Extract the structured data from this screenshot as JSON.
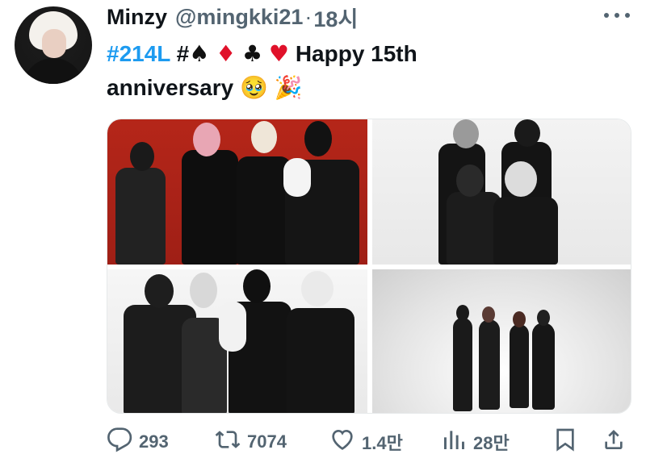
{
  "tweet": {
    "display_name": "Minzy",
    "handle": "@mingkki21",
    "separator": "·",
    "time": "18시",
    "text": {
      "hashtag": "#214L",
      "hash": "#",
      "suits": [
        "♠",
        "♦",
        "♣",
        "♥"
      ],
      "line1_rest": "Happy 15th",
      "line2": "anniversary",
      "emojis": [
        "🥹",
        "🎉"
      ]
    }
  },
  "actions": {
    "replies": "293",
    "retweets": "7074",
    "likes": "1.4만",
    "views": "28만"
  },
  "icons": {
    "reply": "reply-icon",
    "retweet": "retweet-icon",
    "like": "heart-icon",
    "views": "views-icon",
    "bookmark": "bookmark-icon",
    "share": "share-icon",
    "more": "more-icon"
  },
  "colors": {
    "link": "#1d9bf0",
    "text": "#0f1419",
    "muted": "#536471",
    "red": "#e0112a"
  }
}
